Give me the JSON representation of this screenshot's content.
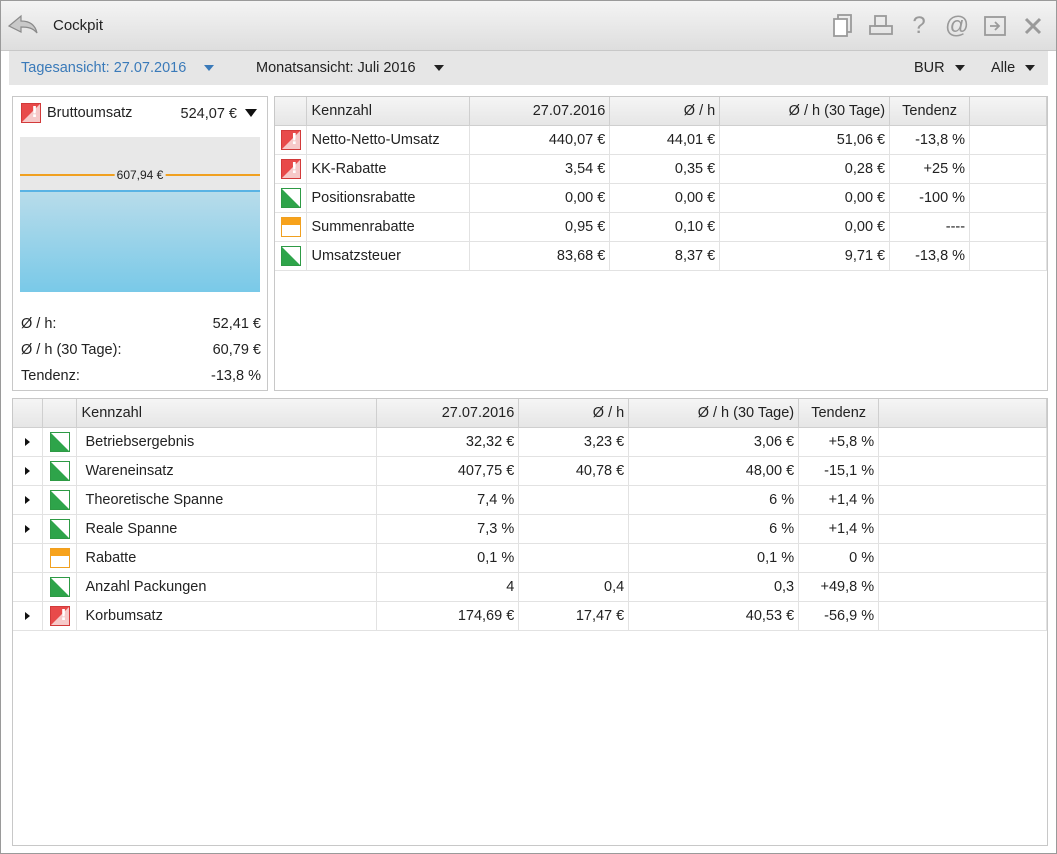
{
  "window": {
    "title": "Cockpit",
    "icons": [
      "back-icon",
      "document-icon",
      "printer-icon",
      "help-icon",
      "at-icon",
      "export-icon",
      "close-icon"
    ]
  },
  "filters": {
    "day_view": "Tagesansicht: 27.07.2016",
    "month_view": "Monatsansicht: Juli 2016",
    "branch": "BUR",
    "scope": "Alle"
  },
  "left_panel": {
    "status": "red",
    "name": "Bruttoumsatz",
    "value": "524,07 €",
    "target_label": "607,94 €",
    "fill_fraction": 0.66,
    "target_fraction": 0.76,
    "stats": [
      {
        "label": "Ø / h:",
        "value": "52,41 €"
      },
      {
        "label": "Ø / h (30 Tage):",
        "value": "60,79 €"
      },
      {
        "label": "Tendenz:",
        "value": "-13,8 %"
      }
    ]
  },
  "top_table": {
    "headers": [
      "Kennzahl",
      "27.07.2016",
      "Ø / h",
      "Ø / h (30 Tage)",
      "Tendenz"
    ],
    "rows": [
      {
        "status": "red",
        "name": "Netto-Netto-Umsatz",
        "day": "440,07 €",
        "avg_h": "44,01 €",
        "avg_30": "51,06 €",
        "trend": "-13,8 %"
      },
      {
        "status": "red",
        "name": "KK-Rabatte",
        "day": "3,54 €",
        "avg_h": "0,35 €",
        "avg_30": "0,28 €",
        "trend": "+25 %"
      },
      {
        "status": "green",
        "name": "Positionsrabatte",
        "day": "0,00 €",
        "avg_h": "0,00 €",
        "avg_30": "0,00 €",
        "trend": "-100 %"
      },
      {
        "status": "orange",
        "name": "Summenrabatte",
        "day": "0,95 €",
        "avg_h": "0,10 €",
        "avg_30": "0,00 €",
        "trend": "----"
      },
      {
        "status": "green",
        "name": "Umsatzsteuer",
        "day": "83,68 €",
        "avg_h": "8,37 €",
        "avg_30": "9,71 €",
        "trend": "-13,8 %"
      }
    ]
  },
  "bottom_table": {
    "headers": [
      "Kennzahl",
      "27.07.2016",
      "Ø / h",
      "Ø / h (30 Tage)",
      "Tendenz"
    ],
    "rows": [
      {
        "expandable": true,
        "status": "green",
        "name": "Betriebsergebnis",
        "day": "32,32 €",
        "avg_h": "3,23 €",
        "avg_30": "3,06 €",
        "trend": "+5,8 %"
      },
      {
        "expandable": true,
        "status": "green",
        "name": "Wareneinsatz",
        "day": "407,75 €",
        "avg_h": "40,78 €",
        "avg_30": "48,00 €",
        "trend": "-15,1 %"
      },
      {
        "expandable": true,
        "status": "green",
        "name": "Theoretische Spanne",
        "day": "7,4 %",
        "avg_h": "",
        "avg_30": "6 %",
        "trend": "+1,4 %"
      },
      {
        "expandable": true,
        "status": "green",
        "name": "Reale Spanne",
        "day": "7,3 %",
        "avg_h": "",
        "avg_30": "6 %",
        "trend": "+1,4 %"
      },
      {
        "expandable": false,
        "status": "orange",
        "name": "Rabatte",
        "day": "0,1 %",
        "avg_h": "",
        "avg_30": "0,1 %",
        "trend": "0 %"
      },
      {
        "expandable": false,
        "status": "green",
        "name": "Anzahl Packungen",
        "day": "4",
        "avg_h": "0,4",
        "avg_30": "0,3",
        "trend": "+49,8 %"
      },
      {
        "expandable": true,
        "status": "red",
        "name": "Korbumsatz",
        "day": "174,69 €",
        "avg_h": "17,47 €",
        "avg_30": "40,53 €",
        "trend": "-56,9 %"
      }
    ]
  }
}
